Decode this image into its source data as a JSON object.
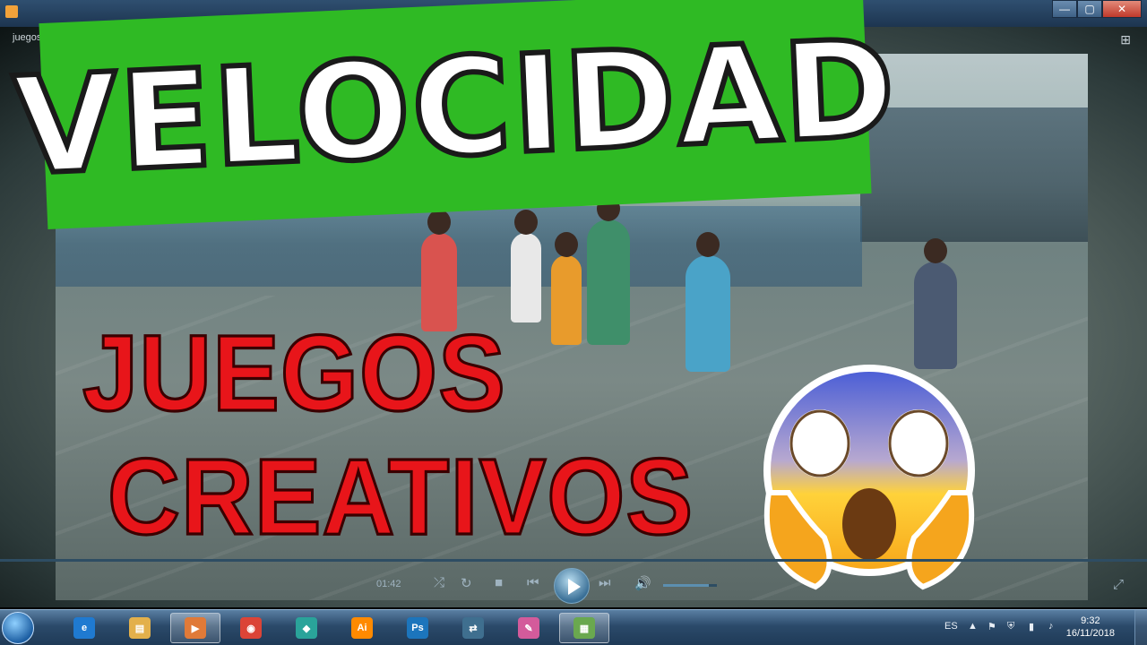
{
  "window": {
    "path_text": "juegos de velocidad para niños educ...",
    "controls": {
      "minimize": "—",
      "maximize": "▢",
      "close": "✕"
    }
  },
  "video": {
    "title_banner": "VELOCIDAD",
    "caption_line1": "JUEGOS",
    "caption_line2": "CREATIVOS",
    "emoji": "screaming-face"
  },
  "player": {
    "current_time": "01:42",
    "buttons": [
      "shuffle",
      "repeat",
      "stop",
      "previous",
      "play",
      "next",
      "volume"
    ],
    "volume_fraction": 0.85,
    "colors": {
      "seek": "#2e4d63",
      "accent": "#5c8fb0"
    }
  },
  "taskbar": {
    "apps": [
      {
        "name": "internet-explorer",
        "glyph": "e",
        "color": "#1f7ad1"
      },
      {
        "name": "file-explorer",
        "glyph": "▤",
        "color": "#e3b04b"
      },
      {
        "name": "media-player",
        "glyph": "▶",
        "color": "#e07a38"
      },
      {
        "name": "chrome",
        "glyph": "◉",
        "color": "#db4437"
      },
      {
        "name": "filmora",
        "glyph": "◆",
        "color": "#2aa39a"
      },
      {
        "name": "illustrator",
        "glyph": "Ai",
        "color": "#ff8a00"
      },
      {
        "name": "photoshop",
        "glyph": "Ps",
        "color": "#1c75bc"
      },
      {
        "name": "video-converter",
        "glyph": "⇄",
        "color": "#3f6f8f"
      },
      {
        "name": "paint",
        "glyph": "✎",
        "color": "#d35b9b"
      },
      {
        "name": "windows-tiles",
        "glyph": "▦",
        "color": "#6aa84f"
      }
    ],
    "language": "ES",
    "time": "9:32",
    "date": "16/11/2018"
  }
}
